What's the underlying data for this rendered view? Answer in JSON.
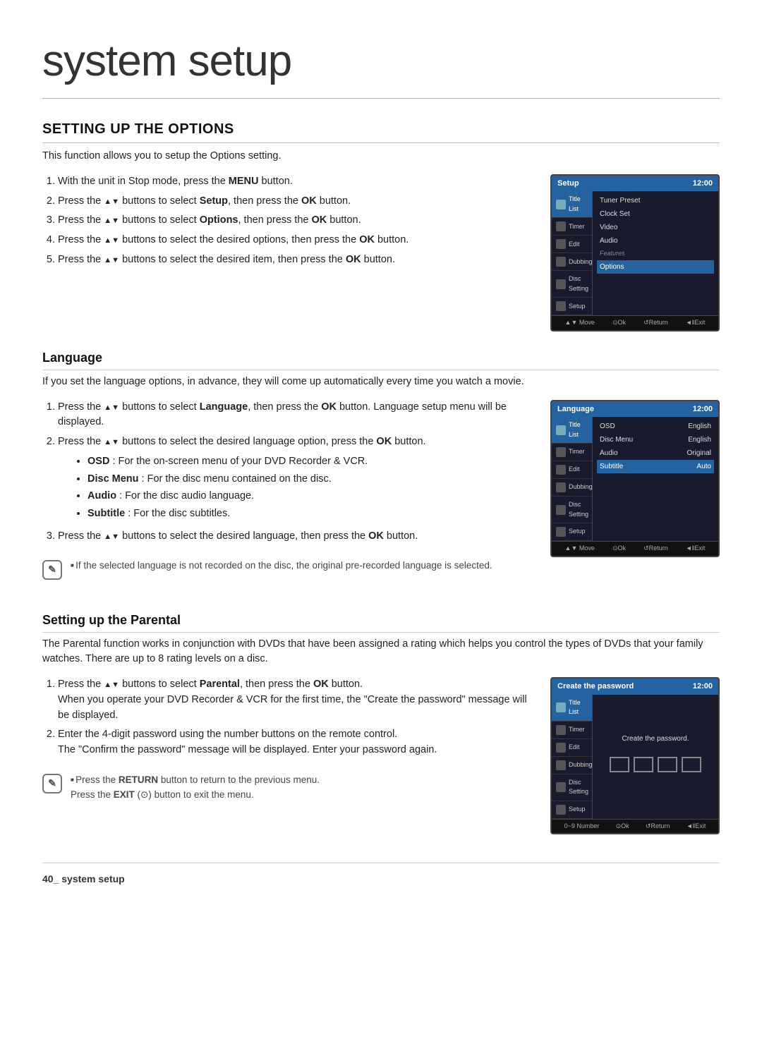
{
  "page": {
    "title": "system setup",
    "footer": "40_ system setup"
  },
  "section1": {
    "heading": "SETTING UP THE OPTIONS",
    "intro": "This function allows you to setup the Options setting.",
    "steps": [
      "With the unit in Stop mode, press the <b>MENU</b> button.",
      "Press the ▲▼ buttons to select <b>Setup</b>, then press the <b>OK</b> button.",
      "Press the ▲▼ buttons to select <b>Options</b>, then press the <b>OK</b> button.",
      "Press the ▲▼ buttons to select the desired options, then press the <b>OK</b> button.",
      "Press the ▲▼ buttons to select the desired item, then press the <b>OK</b> button."
    ],
    "screen": {
      "title": "Setup",
      "time": "12:00",
      "sidebar_items": [
        "Title List",
        "Timer",
        "Edit",
        "Dubbing",
        "Disc Setting",
        "Setup"
      ],
      "menu_items": [
        "Tuner Preset",
        "Clock Set",
        "Video",
        "Audio",
        "Features",
        "Options"
      ],
      "highlighted": "Options",
      "bottom": [
        "▲▼ Move",
        "@Ok",
        "↺Return",
        "◄||Exit"
      ]
    }
  },
  "section2": {
    "heading": "Language",
    "intro": "If you set the language options, in advance, they will come up automatically every time you watch a movie.",
    "steps": [
      "Press the ▲▼ buttons to select <b>Language</b>, then press the <b>OK</b> button. Language setup menu will be displayed.",
      "Press the ▲▼ buttons to select the desired language option, press the <b>OK</b> button.",
      "Press the ▲▼ buttons to select the desired language, then press the <b>OK</b> button."
    ],
    "bullets": [
      "<b>OSD</b> : For the on-screen menu of your DVD Recorder &amp; VCR.",
      "<b>Disc Menu</b> : For the disc menu contained on the disc.",
      "<b>Audio</b> : For the disc audio language.",
      "<b>Subtitle</b> : For the disc subtitles."
    ],
    "note": "If the selected language is not recorded on the disc, the original pre-recorded language is selected.",
    "screen": {
      "title": "Language",
      "time": "12:00",
      "sidebar_items": [
        "Title List",
        "Timer",
        "Edit",
        "Dubbing",
        "Disc Setting",
        "Setup"
      ],
      "menu_items": [
        {
          "label": "OSD",
          "value": "English"
        },
        {
          "label": "Disc Menu",
          "value": "English"
        },
        {
          "label": "Audio",
          "value": "Original"
        },
        {
          "label": "Subtitle",
          "value": "Auto"
        }
      ],
      "highlighted": "Subtitle",
      "bottom": [
        "▲▼ Move",
        "@Ok",
        "↺Return",
        "◄||Exit"
      ]
    }
  },
  "section3": {
    "heading": "Setting up the Parental",
    "intro": "The Parental function works in conjunction with DVDs that have been assigned a rating which helps you control the types of DVDs that your family watches. There are up to 8 rating levels on a disc.",
    "steps": [
      "Press the ▲▼ buttons to select <b>Parental</b>, then press the <b>OK</b> button.\nWhen you operate your DVD Recorder &amp; VCR for the first time, the \"Create the password\" message will be displayed.",
      "Enter the 4-digit password using the number buttons on the remote control.\nThe \"Confirm the password\" message will be displayed. Enter your password again."
    ],
    "note1": "Press the <b>RETURN</b> button to return to the previous menu.",
    "note2": "Press the <b>EXIT</b> (⊙) button to exit the menu.",
    "screen": {
      "title": "Create the password",
      "time": "12:00",
      "sidebar_items": [
        "Title List",
        "Timer",
        "Edit",
        "Dubbing",
        "Disc Setting",
        "Setup"
      ],
      "center_text": "Create the password.",
      "bottom": [
        "0~9 Number",
        "@Ok",
        "↺Return",
        "◄||Exit"
      ]
    }
  }
}
